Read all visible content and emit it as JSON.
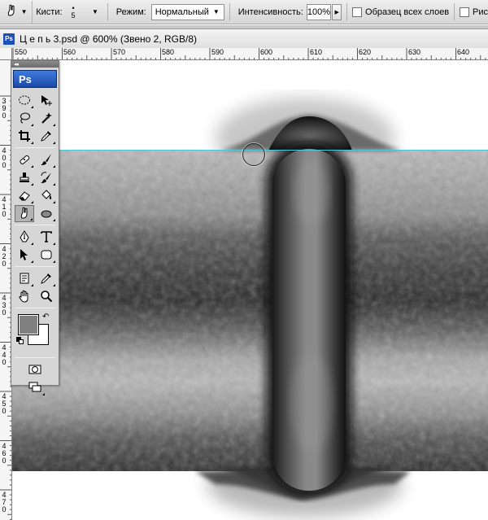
{
  "options_bar": {
    "brushes_label": "Кисти:",
    "brush_size": "5",
    "mode_label": "Режим:",
    "mode_value": "Нормальный",
    "intensity_label": "Интенсивность:",
    "intensity_value": "100%",
    "sample_all_label": "Образец всех слоев",
    "finger_painting_label": "Рис"
  },
  "document": {
    "tab_title": "Ц е п ь 3.psd @ 600% (Звено 2, RGB/8)"
  },
  "rulers": {
    "horizontal": [
      "550",
      "560",
      "570",
      "580",
      "590",
      "600",
      "610",
      "620",
      "630",
      "640"
    ],
    "vertical": [
      [
        "3",
        "9",
        "0"
      ],
      [
        "4",
        "0",
        "0"
      ],
      [
        "4",
        "1",
        "0"
      ],
      [
        "4",
        "2",
        "0"
      ],
      [
        "4",
        "3",
        "0"
      ],
      [
        "4",
        "4",
        "0"
      ],
      [
        "4",
        "5",
        "0"
      ],
      [
        "4",
        "6",
        "0"
      ],
      [
        "4",
        "7",
        "0"
      ]
    ]
  },
  "tools_panel": {
    "logo": "Ps",
    "active_tool": "smudge-tool",
    "foreground_color": "#808080",
    "background_color": "#ffffff"
  },
  "colors": {
    "guide": "#52c6d8",
    "panel": "#d6d6d6",
    "logo_blue": "#1d4fb8"
  }
}
